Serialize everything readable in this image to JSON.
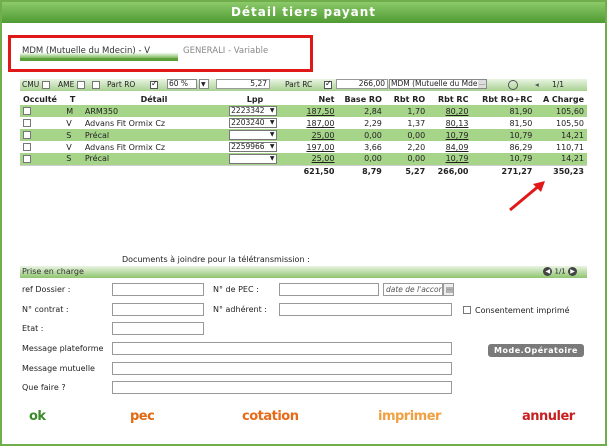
{
  "window": {
    "title": "Détail tiers payant"
  },
  "tabs": [
    {
      "label": "MDM (Mutuelle du Mdecin) - V"
    },
    {
      "label": "GENERALI - Variable"
    }
  ],
  "options": {
    "cmu": "CMU",
    "ame": "AME",
    "part_ro_label": "Part RO",
    "part_ro_pct": "60 %",
    "part_ro_value": "5,27",
    "part_rc_label": "Part RC",
    "part_rc_value": "266,00",
    "mutuelle_select": "MDM (Mutuelle du Mdecin)",
    "pager": "1/1"
  },
  "table": {
    "headers": [
      "Occulté",
      "T",
      "Détail",
      "Lpp",
      "Net",
      "Base RO",
      "Rbt RO",
      "Rbt RC",
      "Rbt RO+RC",
      "A Charge"
    ],
    "rows": [
      {
        "t": "M",
        "detail": "ARM350",
        "lpp": "2223342",
        "net": "187,50",
        "base_ro": "2,84",
        "rbt_ro": "1,70",
        "rbt_rc": "80,20",
        "rbt_total": "81,90",
        "charge": "105,60"
      },
      {
        "t": "V",
        "detail": "Advans Fit Ormix Cz",
        "lpp": "2203240",
        "net": "187,00",
        "base_ro": "2,29",
        "rbt_ro": "1,37",
        "rbt_rc": "80,13",
        "rbt_total": "81,50",
        "charge": "105,50"
      },
      {
        "t": "S",
        "detail": "Précal",
        "lpp": "",
        "net": "25,00",
        "base_ro": "0,00",
        "rbt_ro": "0,00",
        "rbt_rc": "10,79",
        "rbt_total": "10,79",
        "charge": "14,21"
      },
      {
        "t": "V",
        "detail": "Advans Fit Ormix Cz",
        "lpp": "2259966",
        "net": "197,00",
        "base_ro": "3,66",
        "rbt_ro": "2,20",
        "rbt_rc": "84,09",
        "rbt_total": "86,29",
        "charge": "110,71"
      },
      {
        "t": "S",
        "detail": "Précal",
        "lpp": "",
        "net": "25,00",
        "base_ro": "0,00",
        "rbt_ro": "0,00",
        "rbt_rc": "10,79",
        "rbt_total": "10,79",
        "charge": "14,21"
      }
    ],
    "totals": {
      "net": "621,50",
      "base_ro": "8,79",
      "rbt_ro": "5,27",
      "rbt_rc": "266,00",
      "rbt_total": "271,27",
      "charge": "350,23"
    }
  },
  "documents_label": "Documents à joindre pour la télétransmission :",
  "pec": {
    "bar_label": "Prise en charge",
    "pager": "1/1",
    "ref_dossier": "ref Dossier :",
    "no_pec": "N° de PEC :",
    "date_placeholder": "date de l'accord",
    "no_contrat": "N° contrat :",
    "no_adherent": "N° adhérent :",
    "consentement": "Consentement imprimé",
    "etat": "Etat :",
    "message_plateforme": "Message plateforme",
    "message_mutuelle": "Message mutuelle",
    "que_faire": "Que faire ?",
    "mode_operatoire": "Mode.Opératoire"
  },
  "buttons": {
    "ok": "ok",
    "pec": "pec",
    "cotation": "cotation",
    "imprimer": "imprimer",
    "annuler": "annuler"
  },
  "colors": {
    "ok": "#3a8a2a",
    "pec": "#e06a10",
    "cotation": "#e86a18",
    "imprimer": "#f0a040",
    "annuler": "#c82020",
    "highlight_box": "#e01818",
    "arrow": "#e01818",
    "row_green": "#a6d58a"
  }
}
